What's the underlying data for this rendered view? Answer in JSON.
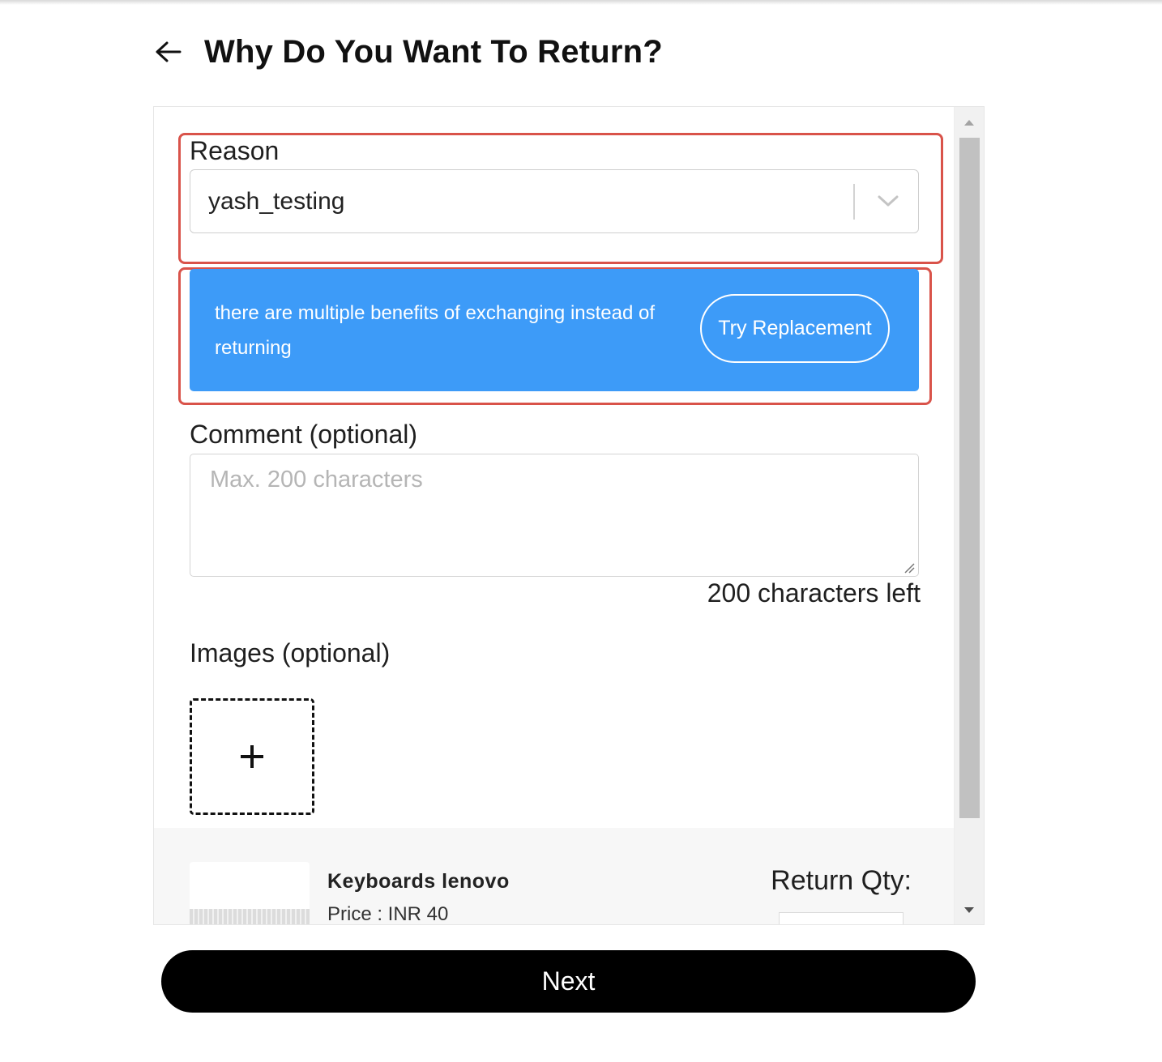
{
  "header": {
    "title": "Why Do You Want To Return?",
    "back_icon": "arrow-left-icon"
  },
  "form": {
    "reason": {
      "label": "Reason",
      "selected_value": "yash_testing"
    },
    "banner": {
      "message": "there are multiple benefits of exchanging instead of returning",
      "button_label": "Try Replacement",
      "background_color": "#3d9bf8"
    },
    "comment": {
      "label": "Comment (optional)",
      "placeholder": "Max. 200 characters",
      "value": "",
      "chars_left": "200 characters left"
    },
    "images": {
      "label": "Images (optional)",
      "add_icon": "plus-icon"
    }
  },
  "product": {
    "name": "Keyboards lenovo",
    "price": "Price : INR 40",
    "qty_label": "Return Qty:"
  },
  "footer": {
    "next_label": "Next"
  },
  "colors": {
    "highlight": "#d9534a",
    "primary_button": "#000000"
  }
}
